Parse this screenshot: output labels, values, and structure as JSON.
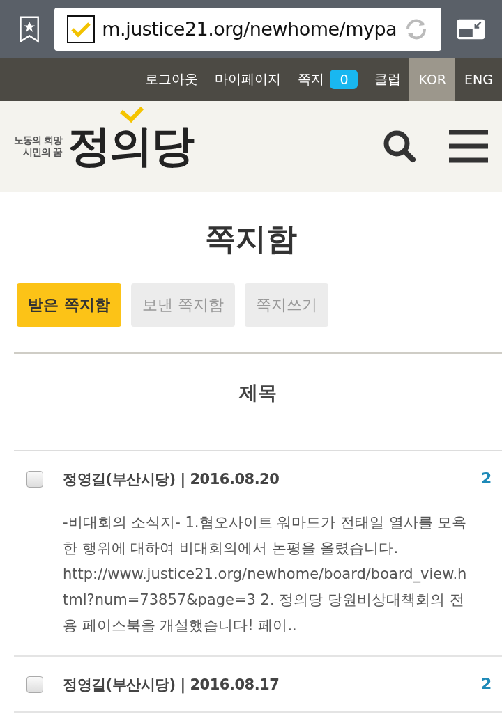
{
  "browser": {
    "url": "m.justice21.org/newhome/mypa"
  },
  "top_nav": {
    "items": [
      {
        "label": "로그아웃",
        "kind": "link"
      },
      {
        "label": "마이페이지",
        "kind": "link"
      },
      {
        "label": "쪽지",
        "kind": "link",
        "badge": "0"
      },
      {
        "label": "클럽",
        "kind": "link"
      }
    ],
    "languages": [
      {
        "label": "KOR",
        "selected": true
      },
      {
        "label": "ENG",
        "selected": false
      }
    ]
  },
  "header": {
    "logo_tagline": [
      "노동의 희망",
      "시민의 꿈"
    ],
    "logo_name": "정의당"
  },
  "page_title": "쪽지함",
  "tabs": [
    {
      "label": "받은 쪽지함",
      "selected": true
    },
    {
      "label": "보낸 쪽지함",
      "selected": false
    },
    {
      "label": "쪽지쓰기",
      "selected": false
    }
  ],
  "table": {
    "columns": [
      "제목"
    ],
    "rows": [
      {
        "checked": false,
        "sender_date": "정영길(부산시당) | 2016.08.20",
        "column_3": "2",
        "body": "-비대회의 소식지- 1.혐오사이트 워마드가 전태일 열사를 모욕한 행위에 대하여 비대회의에서 논평을 올렸습니다. http://www.justice21.org/newhome/board/board_view.html?num=73857&page=3 2. 정의당 당원비상대책회의 전용 페이스북을 개설했습니다! 페이.."
      },
      {
        "checked": false,
        "sender_date": "정영길(부산시당) | 2016.08.17",
        "column_3": "2"
      }
    ]
  }
}
